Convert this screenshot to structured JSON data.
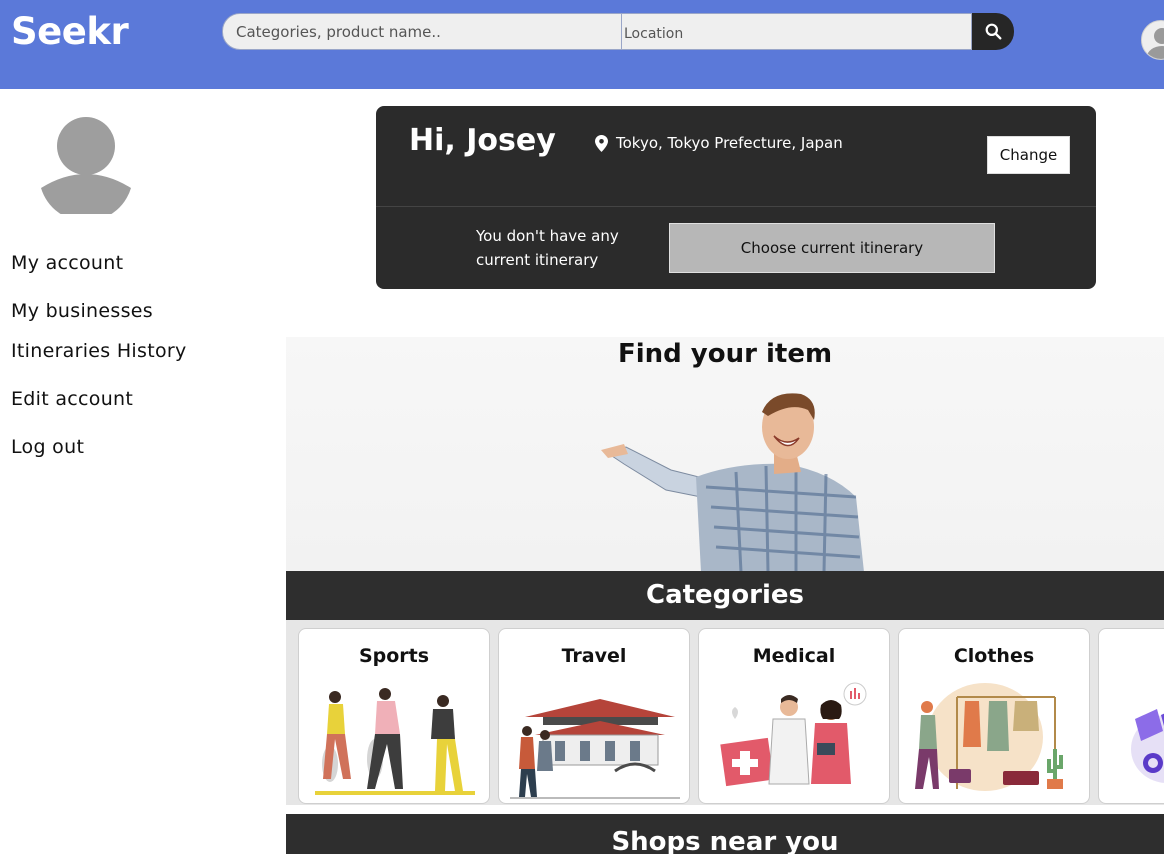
{
  "header": {
    "logo": "Seekr",
    "search_placeholder": "Categories, product name..",
    "location_placeholder": "Location",
    "search_icon": "magnifier-icon",
    "avatar_icon": "user-avatar-icon"
  },
  "sidebar": {
    "avatar_icon": "user-avatar-icon",
    "items": [
      {
        "label": "My account"
      },
      {
        "label": "My businesses"
      },
      {
        "label": "Itineraries History"
      },
      {
        "label": "Edit account"
      },
      {
        "label": "Log out"
      }
    ]
  },
  "greeting": {
    "title": "Hi, Josey",
    "location": "Tokyo, Tokyo Prefecture, Japan",
    "location_icon": "map-pin-icon",
    "change_label": "Change",
    "itinerary_text": "You don't have any current itinerary",
    "choose_label": "Choose current itinerary"
  },
  "hero": {
    "title": "Find your item"
  },
  "categories": {
    "title": "Categories",
    "items": [
      {
        "label": "Sports"
      },
      {
        "label": "Travel"
      },
      {
        "label": "Medical"
      },
      {
        "label": "Clothes"
      },
      {
        "label": ""
      }
    ]
  },
  "shops": {
    "title": "Shops near you"
  },
  "colors": {
    "header_bg": "#5b79d9",
    "dark_panel": "#2b2b2b",
    "choose_button": "#b7b7b7"
  }
}
